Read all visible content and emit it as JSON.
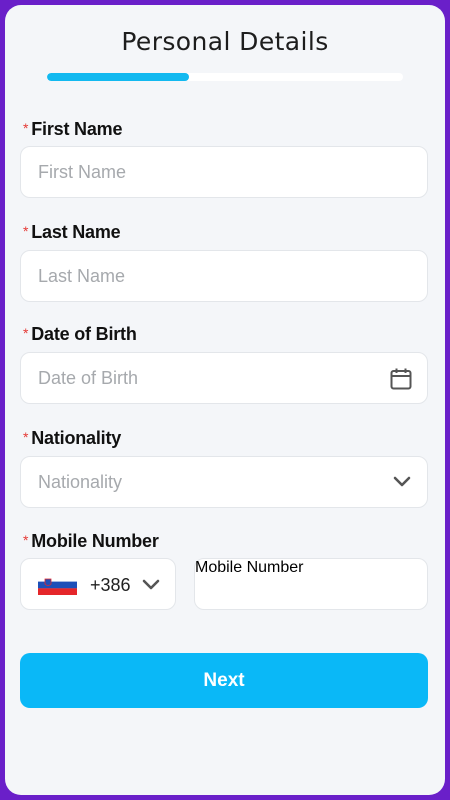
{
  "header": {
    "title": "Personal Details"
  },
  "progress": {
    "fraction": 0.4
  },
  "form": {
    "first_name": {
      "label": "First Name",
      "required_mark": "*",
      "placeholder": "First Name",
      "value": ""
    },
    "last_name": {
      "label": "Last Name",
      "required_mark": "*",
      "placeholder": "Last Name",
      "value": ""
    },
    "date_of_birth": {
      "label": "Date of Birth",
      "required_mark": "*",
      "placeholder": "Date of Birth",
      "value": ""
    },
    "nationality": {
      "label": "Nationality",
      "required_mark": "*",
      "placeholder": "Nationality",
      "value": ""
    },
    "mobile": {
      "label": "Mobile Number",
      "required_mark": "*",
      "country_code": "+386",
      "country_flag": "slovenia",
      "placeholder": "Mobile Number",
      "value": ""
    }
  },
  "actions": {
    "next_label": "Next"
  },
  "colors": {
    "frame": "#6a1fc9",
    "accent": "#0ab8f7",
    "required": "#e53935"
  },
  "icons": {
    "date": "calendar-icon",
    "nationality": "chevron-down-icon",
    "code": "chevron-down-icon"
  }
}
